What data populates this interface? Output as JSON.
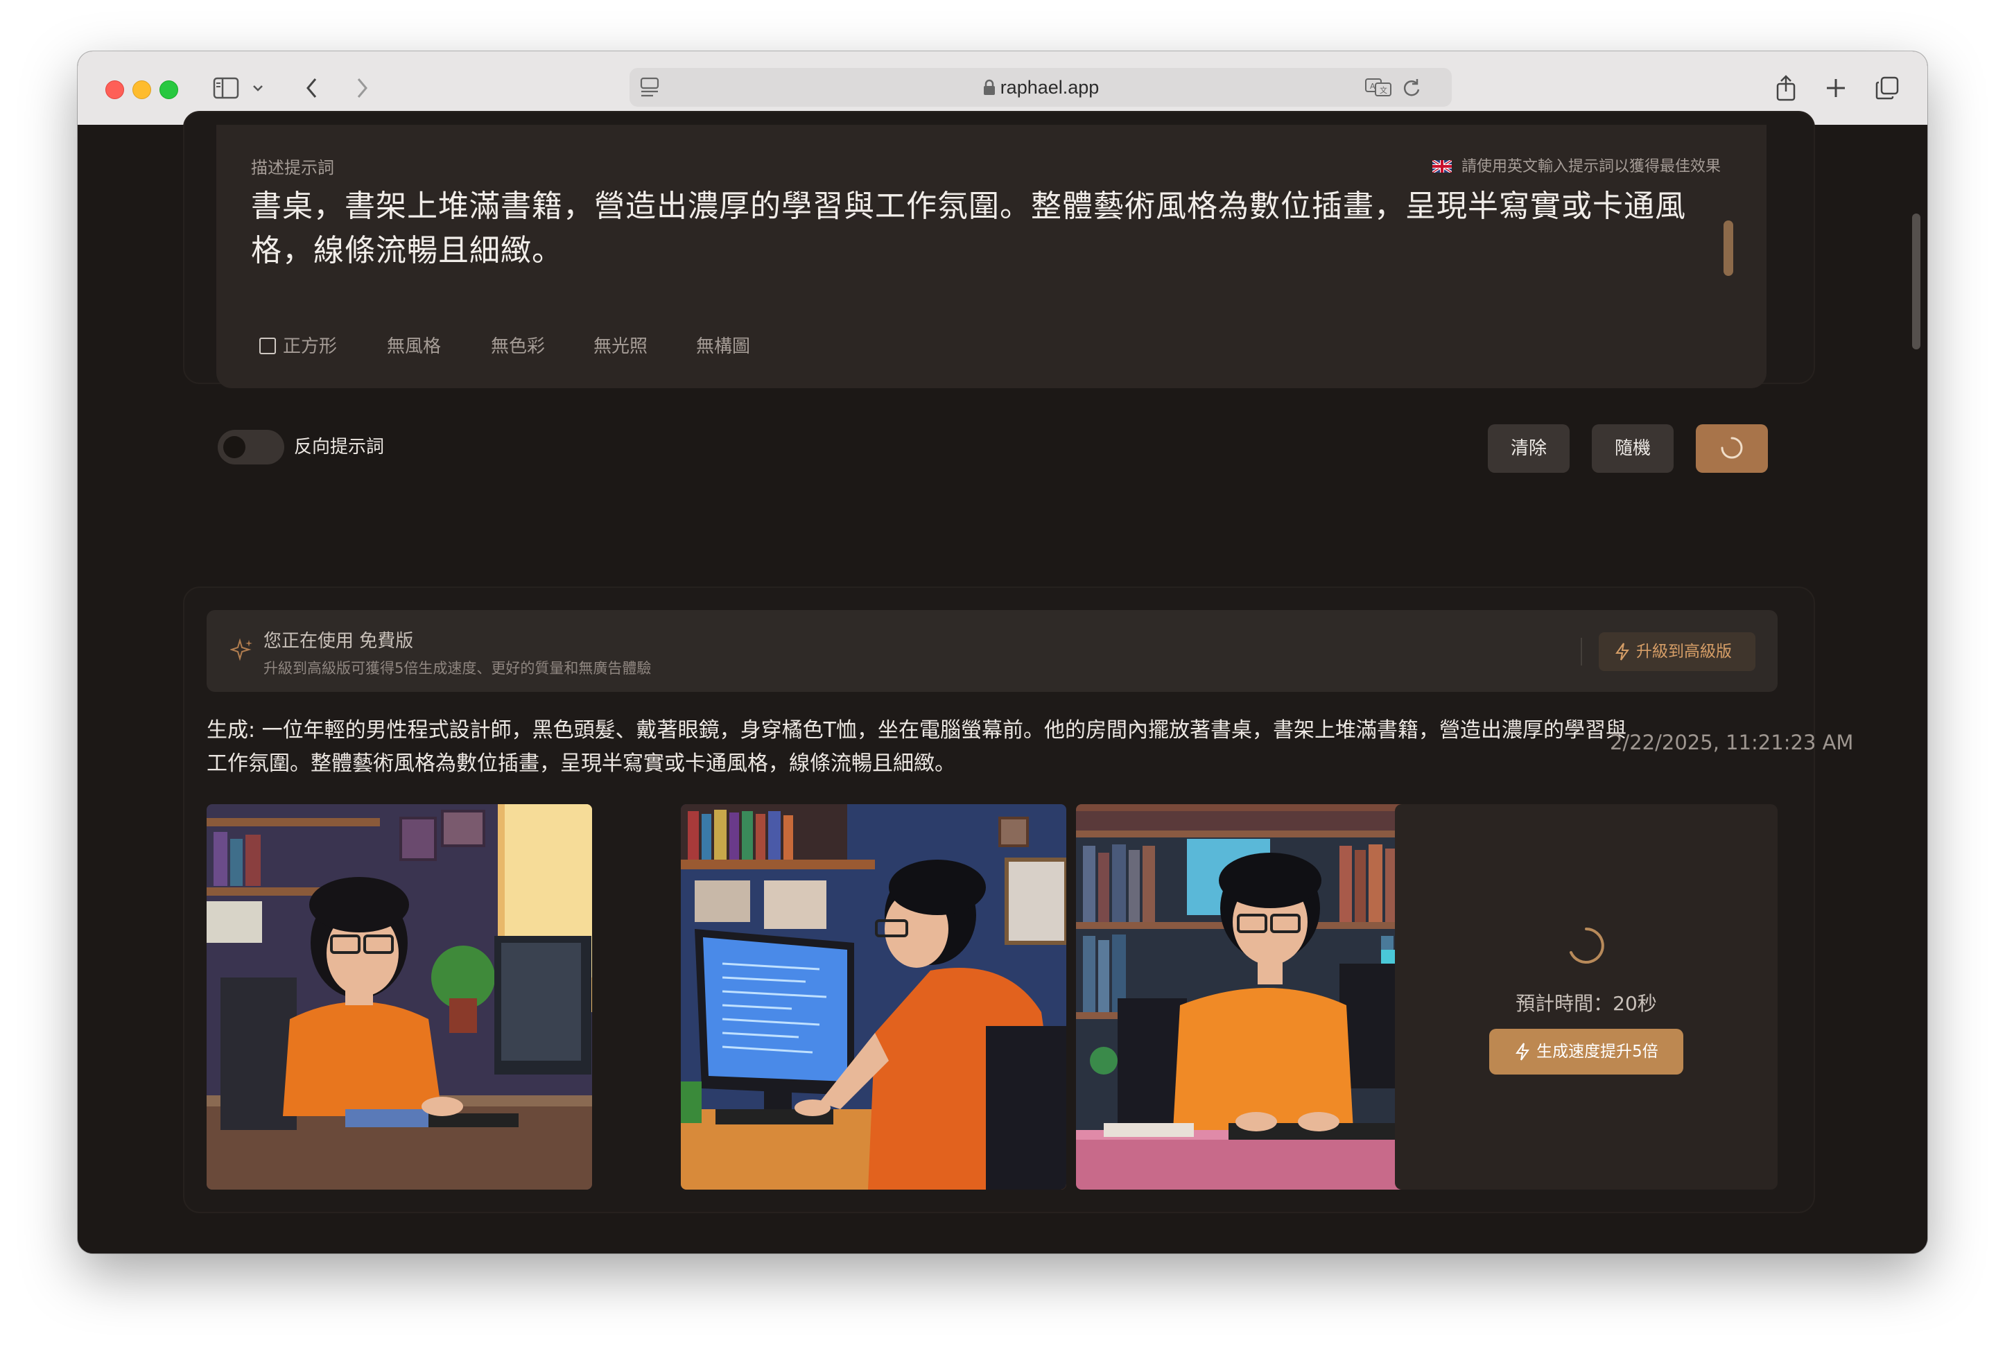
{
  "browser": {
    "url": "raphael.app"
  },
  "prompt_panel": {
    "label": "描述提示詞",
    "hint": "請使用英文輸入提示詞以獲得最佳效果",
    "text": "書桌，書架上堆滿書籍，營造出濃厚的學習與工作氛圍。整體藝術風格為數位插畫，呈現半寫實或卡通風格，線條流暢且細緻。",
    "options": [
      {
        "label": "正方形"
      },
      {
        "label": "無風格"
      },
      {
        "label": "無色彩"
      },
      {
        "label": "無光照"
      },
      {
        "label": "無構圖"
      }
    ],
    "negative_prompt_label": "反向提示詞",
    "negative_prompt_enabled": false,
    "clear_label": "清除",
    "random_label": "隨機"
  },
  "plan_banner": {
    "title_prefix": "您正在使用",
    "plan_name": "免費版",
    "subtitle": "升級到高級版可獲得5倍生成速度、更好的質量和無廣告體驗",
    "upgrade_label": "升級到高級版"
  },
  "generation": {
    "prefix": "生成:",
    "prompt": "一位年輕的男性程式設計師，黑色頭髮、戴著眼鏡，身穿橘色T恤，坐在電腦螢幕前。他的房間內擺放著書桌，書架上堆滿書籍，營造出濃厚的學習與工作氛圍。整體藝術風格為數位插畫，呈現半寫實或卡通風格，線條流暢且細緻。",
    "timestamp": "2/22/2025, 11:21:23 AM",
    "estimated_time": "預計時間：20秒",
    "speed_up_label": "生成速度提升5倍"
  },
  "colors": {
    "accent": "#bd8851",
    "background": "#1c1816",
    "panel": "#2c2623"
  }
}
